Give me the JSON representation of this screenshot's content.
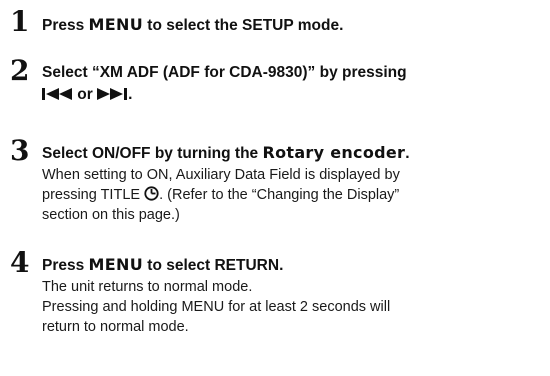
{
  "steps": [
    {
      "number": "1",
      "head_pre": "Press ",
      "head_key": "MENU",
      "head_post": " to select the SETUP mode."
    },
    {
      "number": "2",
      "line1": "Select “XM ADF (ADF for CDA-9830)” by pressing",
      "line2_or": " or ",
      "line2_end": "."
    },
    {
      "number": "3",
      "head_pre": "Select ON/OFF by turning the ",
      "head_key": "Rotary encoder",
      "head_post": ".",
      "desc_line1": "When setting to ON, Auxiliary Data Field is displayed by",
      "desc_line2_pre": "pressing TITLE ",
      "desc_line2_post": ". (Refer to the “Changing the Display”",
      "desc_line3": "section on this page.)"
    },
    {
      "number": "4",
      "head_pre": "Press ",
      "head_key": "MENU",
      "head_post": " to select RETURN.",
      "desc_line1": "The unit returns to normal mode.",
      "desc_line2_pre": "Pressing and holding ",
      "desc_line2_key": "MENU",
      "desc_line2_post": " for at least 2 seconds will",
      "desc_line3": "return to normal mode."
    }
  ]
}
